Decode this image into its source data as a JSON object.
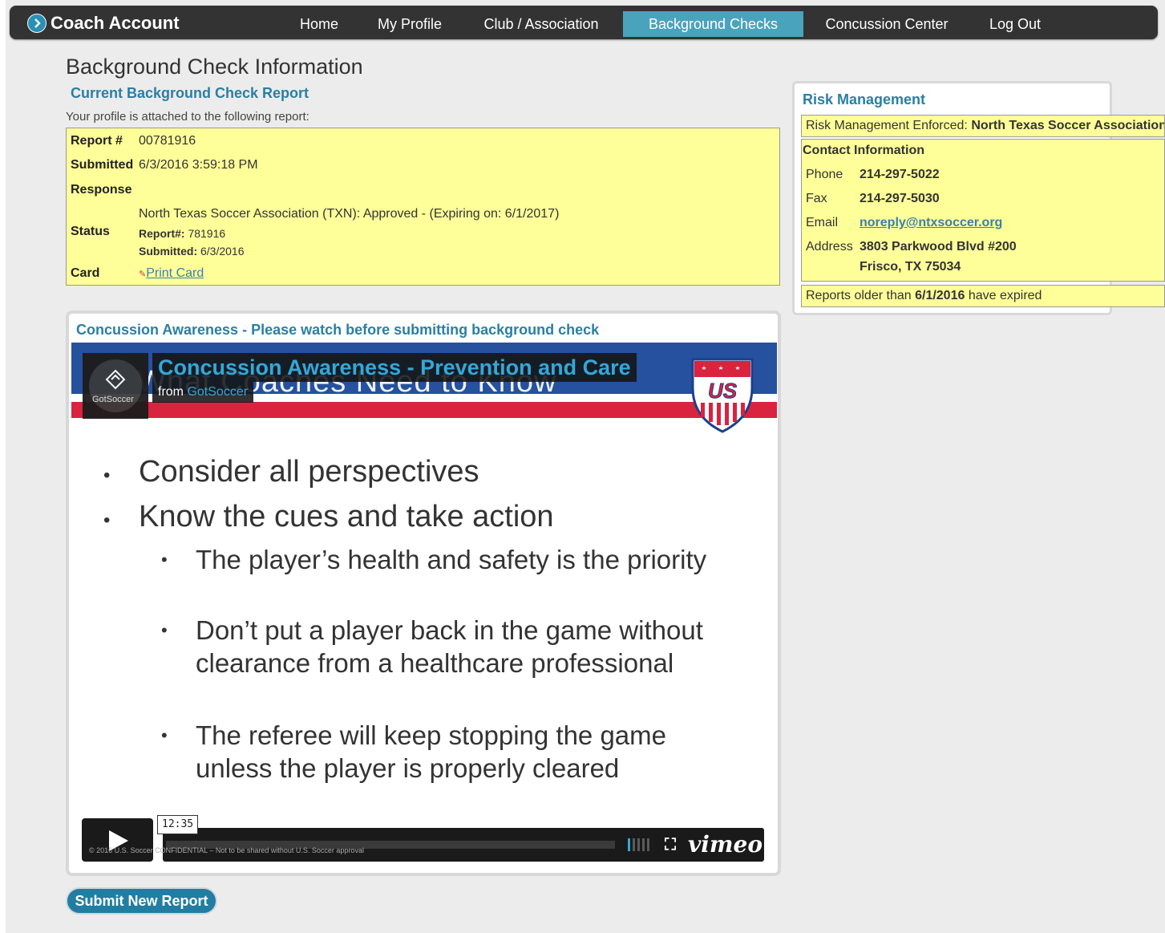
{
  "nav": {
    "brand": "Coach Account",
    "items": [
      "Home",
      "My Profile",
      "Club / Association",
      "Background Checks",
      "Concussion Center",
      "Log Out"
    ],
    "active": "Background Checks"
  },
  "page_title": "Background Check Information",
  "current": {
    "title": "Current Background Check Report",
    "note": "Your profile is attached to the following report:",
    "report_label": "Report #",
    "report_value": "00781916",
    "submitted_label": "Submitted",
    "submitted_value": "6/3/2016 3:59:18 PM",
    "response_label": "Response",
    "status_label": "Status",
    "status_line": "North Texas Soccer Association (TXN): Approved - (Expiring on: 6/1/2017)",
    "status_report_label": "Report#:",
    "status_report_value": "781916",
    "status_submitted_label": "Submitted:",
    "status_submitted_value": "6/3/2016",
    "card_label": "Card",
    "print_card": "Print Card"
  },
  "concussion": {
    "title": "Concussion Awareness - Please watch before submitting background check",
    "video_title": "Concussion Awareness - Prevention and Care",
    "from_label": "from",
    "from_source": "GotSoccer",
    "logo_text": "GotSoccer",
    "slide_heading": "What Coaches Need to Know",
    "bullets": [
      "Consider all perspectives",
      "Know the cues and take action"
    ],
    "sub_bullets": [
      "The player’s health and safety is the priority",
      "Don’t put a player back in the game without clearance from a healthcare professional",
      "The referee will keep stopping the game unless the player is properly cleared"
    ],
    "duration": "12:35",
    "confidential_note": "© 2016 U.S. Soccer CONFIDENTIAL – Not to be shared without U.S. Soccer approval",
    "player_brand": "vimeo",
    "crest_text": "US"
  },
  "submit_button": "Submit New Report",
  "risk": {
    "title": "Risk Management",
    "enforced_label": "Risk Management Enforced:",
    "enforced_value": "North Texas Soccer Association",
    "contact_header": "Contact Information",
    "phone_label": "Phone",
    "phone": "214-297-5022",
    "fax_label": "Fax",
    "fax": "214-297-5030",
    "email_label": "Email",
    "email": "noreply@ntxsoccer.org",
    "address_label": "Address",
    "address_1": "3803 Parkwood Blvd #200",
    "address_2": "Frisco, TX 75034",
    "expired_prefix": "Reports older than",
    "expired_date": "6/1/2016",
    "expired_suffix": "have expired"
  },
  "colors": {
    "nav_bg": "#333333",
    "accent": "#2a7fa3",
    "active_tab": "#4aa3bd",
    "highlight_box": "#ffff99"
  }
}
